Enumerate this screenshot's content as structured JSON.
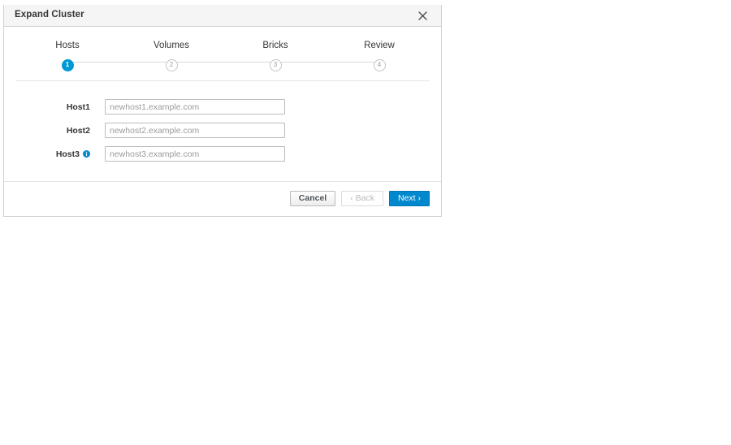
{
  "dialog": {
    "title": "Expand Cluster",
    "close_label": "Close",
    "close_icon": "close-icon"
  },
  "wizard": {
    "steps": [
      {
        "number": "1",
        "label": "Hosts",
        "state": "active"
      },
      {
        "number": "2",
        "label": "Volumes",
        "state": "inactive"
      },
      {
        "number": "3",
        "label": "Bricks",
        "state": "inactive"
      },
      {
        "number": "4",
        "label": "Review",
        "state": "inactive"
      }
    ],
    "active_color": "#0099d3",
    "inactive_color": "#c4c4c4",
    "connector_color": "#d7d7d7"
  },
  "form": {
    "fields": [
      {
        "label": "Host1",
        "value": "newhost1.example.com",
        "placeholder": "newhost1.example.com",
        "info": false
      },
      {
        "label": "Host2",
        "value": "newhost2.example.com",
        "placeholder": "newhost2.example.com",
        "info": false
      },
      {
        "label": "Host3",
        "value": "newhost3.example.com",
        "placeholder": "newhost3.example.com",
        "info": true,
        "info_icon": "info-circle-icon"
      }
    ]
  },
  "footer": {
    "cancel_label": "Cancel",
    "back_label": "‹ Back",
    "next_label": "Next ›",
    "back_disabled": true,
    "primary_color": "#0088ce"
  }
}
